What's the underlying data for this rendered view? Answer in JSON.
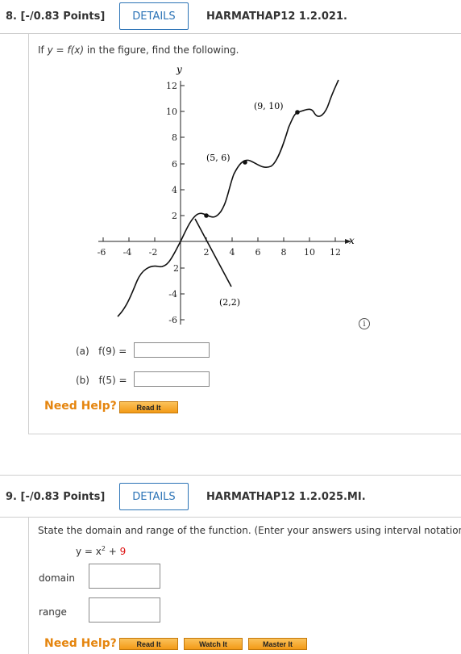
{
  "q8": {
    "points": "8. [-/0.83 Points]",
    "details_label": "DETAILS",
    "code": "HARMATHAP12 1.2.021.",
    "prompt_pre": "If ",
    "prompt_eq": "y = f(x)",
    "prompt_post": " in the figure, find the following.",
    "figure": {
      "y_axis_label": "y",
      "x_axis_label": "x",
      "y_ticks": [
        "12",
        "10",
        "8",
        "6",
        "4",
        "2",
        "2",
        "-4",
        "-6"
      ],
      "x_ticks": [
        "-6",
        "-4",
        "-2",
        "2",
        "4",
        "6",
        "8",
        "10",
        "12"
      ],
      "point_labels": [
        "(9, 10)",
        "(5, 6)",
        "(2,2)"
      ]
    },
    "parts": [
      {
        "label": "(a)",
        "expr": "f(9) ="
      },
      {
        "label": "(b)",
        "expr": "f(5) ="
      }
    ],
    "need_help": "Need Help?",
    "buttons": [
      "Read It"
    ]
  },
  "q9": {
    "points": "9. [-/0.83 Points]",
    "details_label": "DETAILS",
    "code": "HARMATHAP12 1.2.025.MI.",
    "prompt": "State the domain and range of the function. (Enter your answers using interval notation.",
    "function_lhs": "y = x",
    "function_exp": "2",
    "function_plus": " + ",
    "function_const": "9",
    "fields": [
      {
        "label": "domain"
      },
      {
        "label": "range"
      }
    ],
    "need_help": "Need Help?",
    "buttons": [
      "Read It",
      "Watch It",
      "Master It"
    ]
  },
  "colors": {
    "accent": "#2b73b6",
    "help": "#e5850e",
    "button": "#f39a17",
    "red": "#dd1111"
  }
}
